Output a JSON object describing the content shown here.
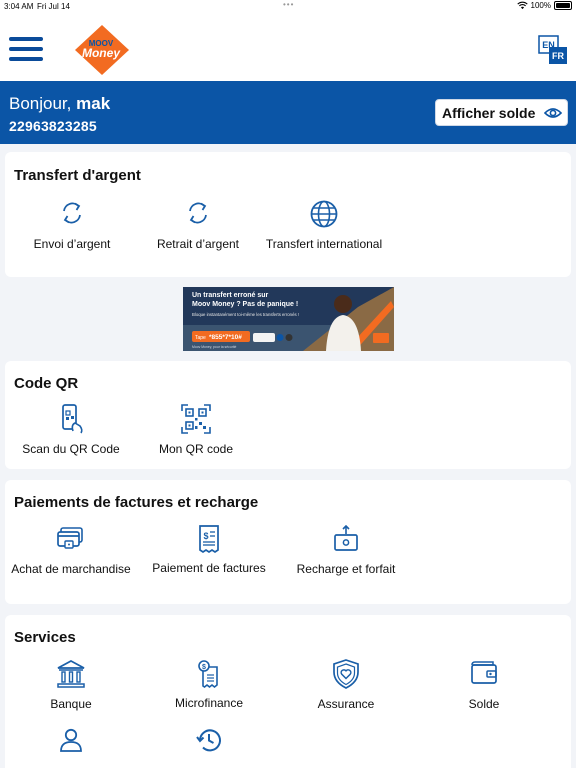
{
  "status_bar": {
    "time": "3:04 AM",
    "date": "Fri Jul 14",
    "battery": "100%"
  },
  "header": {
    "logo_text_top": "MOOV",
    "logo_text_bottom": "Money",
    "lang_primary": "EN",
    "lang_secondary": "FR"
  },
  "account": {
    "greeting": "Bonjour,",
    "user": "mak",
    "phone": "22963823285",
    "show_balance_label": "Afficher solde"
  },
  "sections": {
    "transfer": {
      "title": "Transfert d'argent",
      "items": [
        {
          "label": "Envoi d’argent",
          "icon": "refresh-icon"
        },
        {
          "label": "Retrait d’argent",
          "icon": "refresh-icon"
        },
        {
          "label": "Transfert international",
          "icon": "globe-icon"
        }
      ]
    },
    "qr": {
      "title": "Code QR",
      "items": [
        {
          "label": "Scan du QR Code",
          "icon": "phone-qr-icon"
        },
        {
          "label": "Mon QR code",
          "icon": "qr-code-icon"
        }
      ]
    },
    "payments": {
      "title": "Paiements de factures et recharge",
      "items": [
        {
          "label": "Achat de marchandise",
          "icon": "card-icon"
        },
        {
          "label": "Paiement de factures",
          "icon": "bill-icon"
        },
        {
          "label": "Recharge et forfait",
          "icon": "topup-icon"
        }
      ]
    },
    "services": {
      "title": "Services",
      "items": [
        {
          "label": "Banque",
          "icon": "bank-icon"
        },
        {
          "label": "Microfinance",
          "icon": "microfinance-icon"
        },
        {
          "label": "Assurance",
          "icon": "shield-heart-icon"
        },
        {
          "label": "Solde",
          "icon": "wallet-icon"
        },
        {
          "label": "",
          "icon": "user-icon"
        },
        {
          "label": "",
          "icon": "history-icon"
        }
      ]
    }
  },
  "promo": {
    "headline_1": "Un transfert erroné sur",
    "headline_2": "Moov Money ? Pas de panique !",
    "body": "Bloque instantanément toi-même les transferts erronés !",
    "tape_label": "Tape",
    "ussd": "*855*7*10#",
    "footer": "Moov Money, pour ta sécurité"
  },
  "colors": {
    "brand_blue": "#0b55a6",
    "brand_orange": "#f26b21",
    "icon_blue": "#1a5fa8"
  }
}
